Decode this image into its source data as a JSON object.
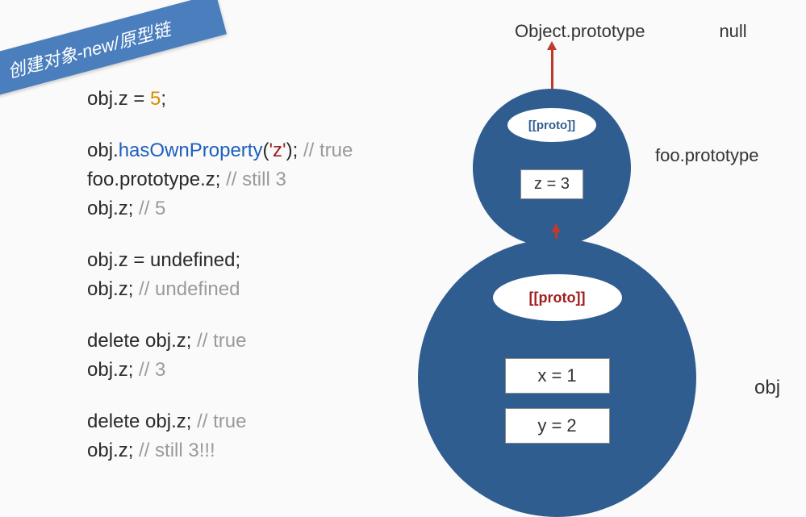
{
  "banner": "创建对象-new/原型链",
  "code": {
    "g1_l1_a": "obj.z = ",
    "g1_l1_b": "5",
    "g1_l1_c": ";",
    "g2_l1_a": "obj.",
    "g2_l1_b": "hasOwnProperty",
    "g2_l1_c": "(",
    "g2_l1_d": "'z'",
    "g2_l1_e": "); ",
    "g2_l1_f": "// true",
    "g2_l2_a": "foo.prototype.z; ",
    "g2_l2_b": "// still 3",
    "g2_l3_a": "obj.z; ",
    "g2_l3_b": "// 5",
    "g3_l1_a": "obj.z = undefined;",
    "g3_l2_a": "obj.z; ",
    "g3_l2_b": "// undefined",
    "g4_l1_a": "delete obj.z; ",
    "g4_l1_b": "// true",
    "g4_l2_a": "obj.z; ",
    "g4_l2_b": "// 3",
    "g5_l1_a": "delete obj.z; ",
    "g5_l1_b": "// true",
    "g5_l2_a": "obj.z; ",
    "g5_l2_b": "// still 3!!!"
  },
  "top": {
    "object_prototype": "Object.prototype",
    "null": "null"
  },
  "small": {
    "proto": "[[proto]]",
    "z": "z = 3",
    "label": "foo.prototype"
  },
  "big": {
    "proto": "[[proto]]",
    "x": "x = 1",
    "y": "y = 2",
    "label": "obj"
  }
}
